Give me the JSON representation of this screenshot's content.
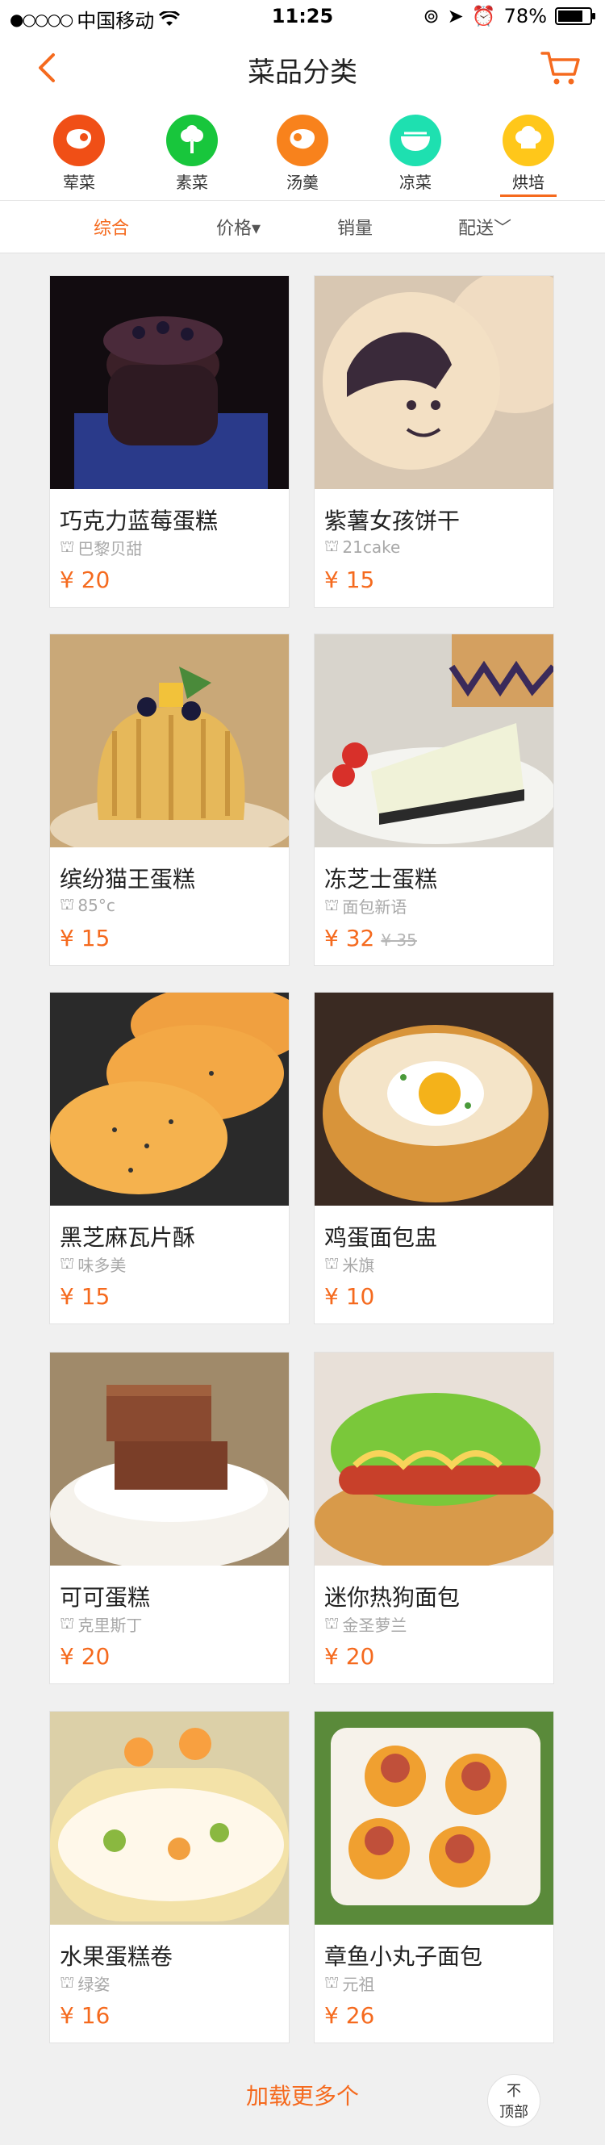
{
  "status": {
    "carrier": "中国移动",
    "time": "11:25",
    "battery": "78%"
  },
  "nav": {
    "title": "菜品分类"
  },
  "categories": [
    {
      "label": "荤菜",
      "color": "#f04f16",
      "icon": "meat-icon"
    },
    {
      "label": "素菜",
      "color": "#18c63c",
      "icon": "vegetable-icon"
    },
    {
      "label": "汤羹",
      "color": "#f8821c",
      "icon": "soup-icon"
    },
    {
      "label": "凉菜",
      "color": "#1ee0b0",
      "icon": "cold-dish-icon"
    },
    {
      "label": "烘培",
      "color": "#ffc71a",
      "icon": "chef-hat-icon",
      "active": true
    }
  ],
  "filters": [
    {
      "label": "综合",
      "active": true
    },
    {
      "label": "价格▾"
    },
    {
      "label": "销量"
    },
    {
      "label": "配送﹀"
    }
  ],
  "products": [
    {
      "name": "巧克力蓝莓蛋糕",
      "brand": "巴黎贝甜",
      "price": "¥ 20"
    },
    {
      "name": "紫薯女孩饼干",
      "brand": "21cake",
      "price": "¥ 15"
    },
    {
      "name": "缤纷猫王蛋糕",
      "brand": "85°c",
      "price": "¥ 15"
    },
    {
      "name": "冻芝士蛋糕",
      "brand": "面包新语",
      "price": "¥ 32",
      "old_price": "¥ 35"
    },
    {
      "name": "黑芝麻瓦片酥",
      "brand": "味多美",
      "price": "¥ 15"
    },
    {
      "name": "鸡蛋面包盅",
      "brand": "米旗",
      "price": "¥ 10"
    },
    {
      "name": "可可蛋糕",
      "brand": "克里斯丁",
      "price": "¥ 20"
    },
    {
      "name": "迷你热狗面包",
      "brand": "金圣萝兰",
      "price": "¥ 20"
    },
    {
      "name": "水果蛋糕卷",
      "brand": "绿姿",
      "price": "¥ 16"
    },
    {
      "name": "章鱼小丸子面包",
      "brand": "元祖",
      "price": "¥ 26"
    }
  ],
  "footer": {
    "load_more": "加载更多个",
    "top_line1": "不",
    "top_line2": "顶部"
  },
  "colors": {
    "accent": "#f56a1e"
  }
}
